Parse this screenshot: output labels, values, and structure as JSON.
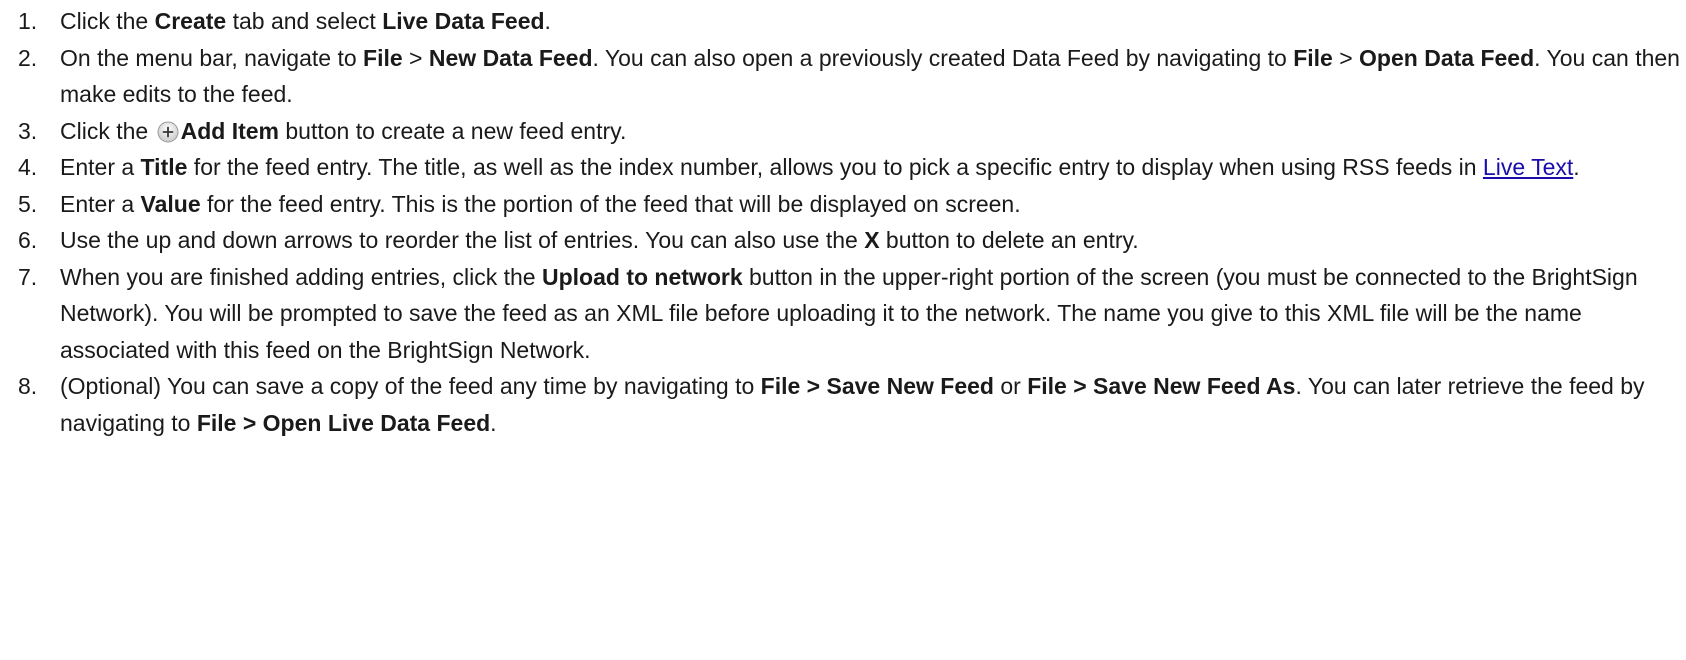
{
  "steps": [
    {
      "num": "1.",
      "parts": [
        "Click the ",
        "Create",
        " tab and select ",
        "Live Data Feed",
        "."
      ]
    },
    {
      "num": "2.",
      "parts": [
        "On the menu bar, navigate to ",
        "File",
        " > ",
        "New Data Feed",
        ". You can also open a previously created Data Feed by navigating to ",
        "File",
        " > ",
        "Open Data Feed",
        ". You can then make edits to the feed."
      ]
    },
    {
      "num": "3.",
      "parts": [
        "Click the ",
        "Add Item",
        " button to create a new feed entry."
      ]
    },
    {
      "num": "4.",
      "parts": [
        "Enter a ",
        "Title",
        " for the feed entry. The title, as well as the index number, allows you to pick a specific entry to display when using RSS feeds in ",
        "Live Text",
        "."
      ]
    },
    {
      "num": "5.",
      "parts": [
        "Enter a ",
        "Value",
        " for the feed entry. This is the portion of the feed that will be displayed on screen."
      ]
    },
    {
      "num": "6.",
      "parts": [
        "Use the up and down arrows to reorder the list of entries. You can also use the ",
        "X",
        " button to delete an entry."
      ]
    },
    {
      "num": "7.",
      "parts": [
        "When you are finished adding entries, click the ",
        "Upload to network",
        " button in the upper-right portion of the screen (you must be connected to the BrightSign Network). You will be prompted to save the feed as an XML file before uploading it to the network. The name you give to this XML file will be the name associated with this feed on the BrightSign Network."
      ]
    },
    {
      "num": "8.",
      "parts": [
        "(Optional) You can save a copy of the feed any time by navigating to ",
        "File > Save New Feed",
        " or ",
        "File > Save New Feed As",
        ". You can later retrieve the feed by navigating to ",
        "File > Open Live Data Feed",
        "."
      ]
    }
  ],
  "icons": {
    "add_item": "add-circle-icon"
  }
}
